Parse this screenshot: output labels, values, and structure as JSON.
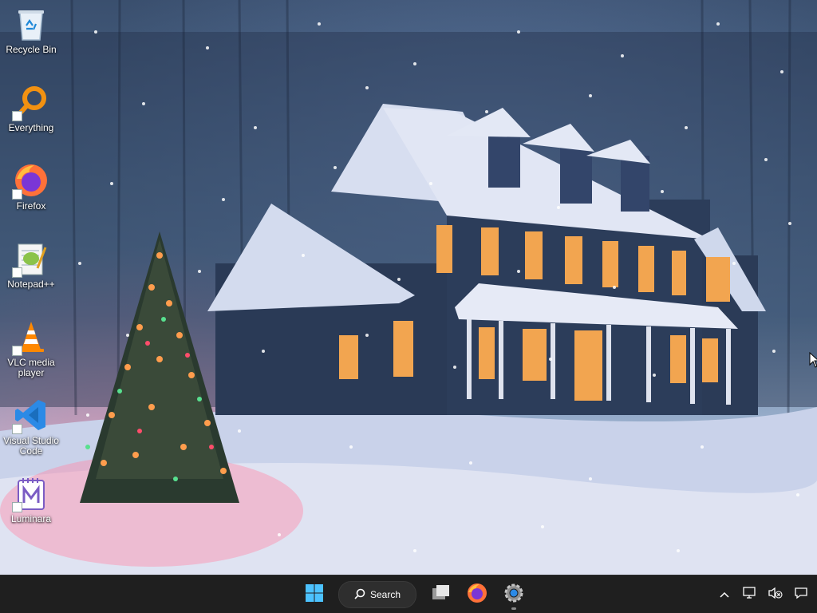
{
  "desktop": {
    "icons": [
      {
        "label": "Recycle Bin",
        "icon": "recycle-bin-icon",
        "shortcut": false
      },
      {
        "label": "Everything",
        "icon": "everything-search-icon",
        "shortcut": true
      },
      {
        "label": "Firefox",
        "icon": "firefox-icon",
        "shortcut": true
      },
      {
        "label": "Notepad++",
        "icon": "notepad-plus-plus-icon",
        "shortcut": true
      },
      {
        "label": "VLC media player",
        "icon": "vlc-cone-icon",
        "shortcut": true
      },
      {
        "label": "Visual Studio Code",
        "icon": "vscode-icon",
        "shortcut": true
      },
      {
        "label": "Luminara",
        "icon": "luminara-icon",
        "shortcut": true
      }
    ]
  },
  "taskbar": {
    "start_icon": "windows-start-icon",
    "search_label": "Search",
    "items": [
      {
        "icon": "task-view-icon",
        "running": false
      },
      {
        "icon": "firefox-icon",
        "running": false
      },
      {
        "icon": "settings-gear-icon",
        "running": true
      }
    ],
    "tray": [
      "chevron-up-icon",
      "network-icon",
      "volume-muted-icon",
      "notification-icon"
    ]
  },
  "colors": {
    "taskbar_bg": "#1f1f1f",
    "accent_blue": "#2b8ae6",
    "everything_orange": "#f29111"
  }
}
